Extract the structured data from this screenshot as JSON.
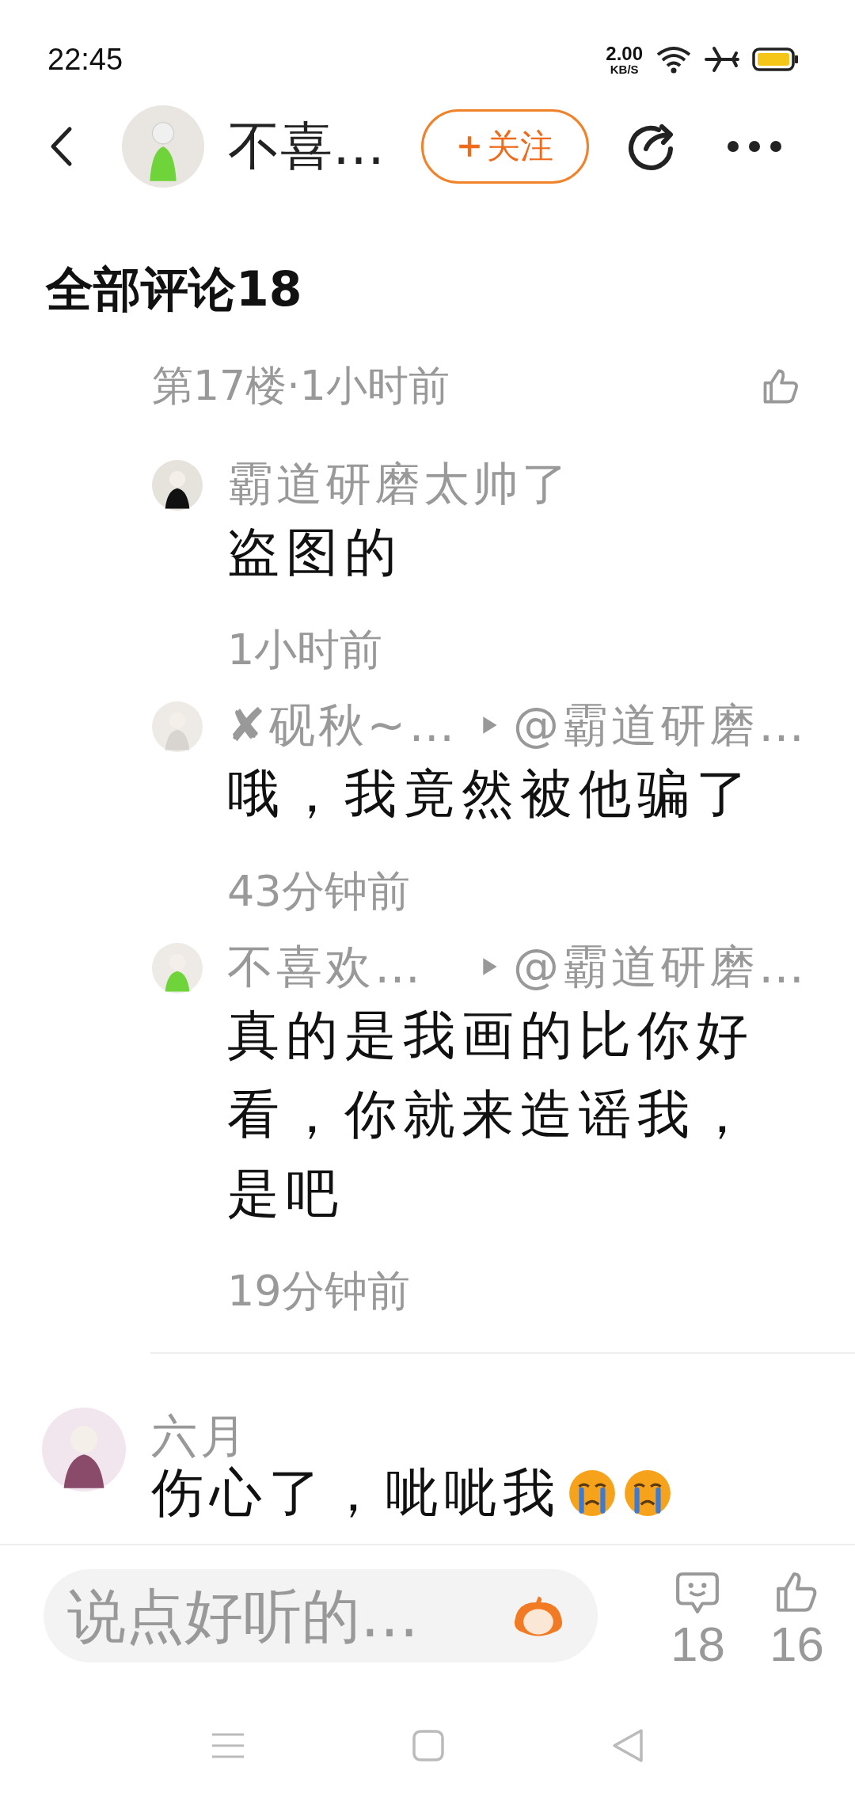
{
  "status_bar": {
    "time": "22:45",
    "net_speed": "2.00",
    "net_unit": "KB/S"
  },
  "header": {
    "author": "不喜…",
    "follow_label": "关注"
  },
  "comments_title": "全部评论18",
  "thread": {
    "meta": "第17楼·1小时前",
    "replies": [
      {
        "user": "霸道研磨太帅了",
        "text": "盗图的",
        "time": "1小时前"
      },
      {
        "user": "✘砚秋~…",
        "reply_to": "@霸道研磨…",
        "text": "哦，我竟然被他骗了",
        "time": "43分钟前"
      },
      {
        "user": "不喜欢…",
        "reply_to": "@霸道研磨…",
        "text": "真的是我画的比你好看，你就来造谣我，是吧",
        "time": "19分钟前"
      }
    ]
  },
  "comments": [
    {
      "user": "六月",
      "text": "伤心了，呲呲我"
    }
  ],
  "composer": {
    "placeholder": "说点好听的…",
    "comment_count": "18",
    "like_count": "16"
  }
}
